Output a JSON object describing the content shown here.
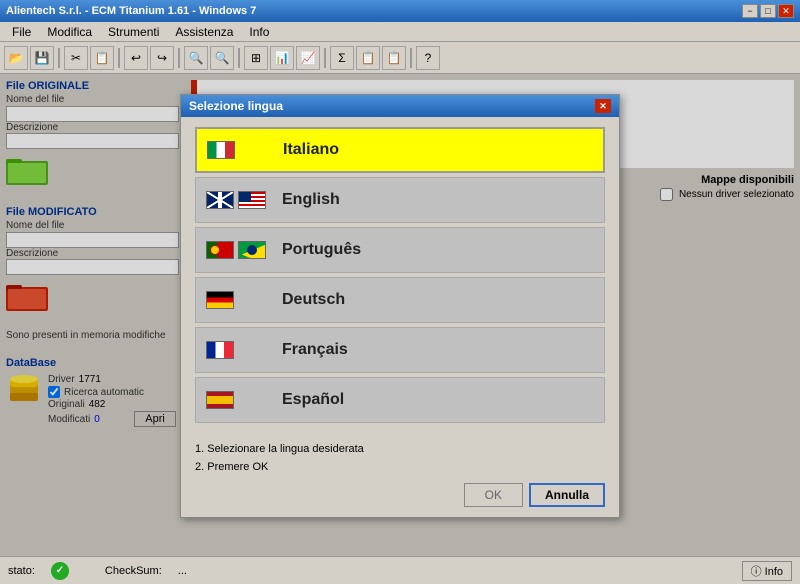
{
  "window": {
    "title": "Alientech S.r.l. - ECM Titanium 1.61 - Windows 7",
    "min_label": "−",
    "max_label": "□",
    "close_label": "✕"
  },
  "menu": {
    "items": [
      "File",
      "Modifica",
      "Strumenti",
      "Assistenza",
      "Info"
    ]
  },
  "toolbar": {
    "buttons": [
      "📂",
      "💾",
      "✂",
      "📋",
      "⎌",
      "⎌",
      "🔍",
      "🔍",
      "⊞",
      "📊",
      "📊",
      "📊",
      "Σ",
      "📊",
      "📊",
      "?"
    ]
  },
  "left_panel": {
    "file_originale": {
      "header": "File ORIGINALE",
      "nome_label": "Nome del file",
      "nome_value": "",
      "descrizione_label": "Descrizione",
      "descrizione_value": ""
    },
    "file_modificato": {
      "header": "File MODIFICATO",
      "nome_label": "Nome del file",
      "nome_value": "",
      "descrizione_label": "Descrizione",
      "descrizione_value": ""
    },
    "sono_presenti": "Sono presenti in memoria modifiche",
    "database": {
      "header": "DataBase",
      "driver_label": "Driver",
      "driver_value": "1771",
      "ricerca_label": "Ricerca automatic",
      "originali_label": "Originali",
      "originali_value": "482",
      "modificati_label": "Modificati",
      "modificati_value": "0",
      "apri_label": "Apri",
      "checkbox_checked": true
    }
  },
  "right_panel": {
    "mappe_label": "Mappe disponibili",
    "no_driver_label": "Nessun driver selezionato"
  },
  "status_bar": {
    "stato_label": "stato:",
    "checksum_label": "CheckSum:",
    "checksum_value": "...",
    "info_label": "ⓘ Info"
  },
  "dialog": {
    "title": "Selezione lingua",
    "close_label": "✕",
    "languages": [
      {
        "name": "Italiano",
        "flags": [
          "it"
        ],
        "selected": true
      },
      {
        "name": "English",
        "flags": [
          "gb",
          "us"
        ],
        "selected": false
      },
      {
        "name": "Português",
        "flags": [
          "pt",
          "br"
        ],
        "selected": false
      },
      {
        "name": "Deutsch",
        "flags": [
          "de"
        ],
        "selected": false
      },
      {
        "name": "Français",
        "flags": [
          "fr"
        ],
        "selected": false
      },
      {
        "name": "Español",
        "flags": [
          "es"
        ],
        "selected": false
      }
    ],
    "instructions": [
      "1. Selezionare la lingua desiderata",
      "2. Premere OK"
    ],
    "ok_label": "OK",
    "annulla_label": "Annulla"
  }
}
